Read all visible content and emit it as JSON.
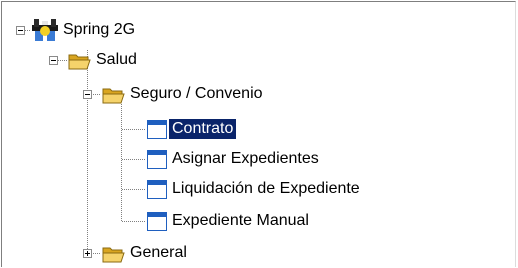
{
  "tree": {
    "root": {
      "label": "Spring 2G",
      "icon": "app-logo-icon",
      "expanded": true
    },
    "salud": {
      "label": "Salud",
      "icon": "folder-open-icon",
      "expanded": true
    },
    "seguro": {
      "label": "Seguro / Convenio",
      "icon": "folder-open-icon",
      "expanded": true
    },
    "items": [
      {
        "label": "Contrato",
        "icon": "form-window-icon",
        "selected": true
      },
      {
        "label": "Asignar Expedientes",
        "icon": "form-window-icon",
        "selected": false
      },
      {
        "label": "Liquidación de Expediente",
        "icon": "form-window-icon",
        "selected": false
      },
      {
        "label": "Expediente Manual",
        "icon": "form-window-icon",
        "selected": false
      }
    ],
    "general": {
      "label": "General",
      "icon": "folder-icon",
      "expanded": false
    }
  },
  "colors": {
    "selection": "#0a246a",
    "folder": "#f2c94c",
    "window_title": "#1f5fbf"
  }
}
